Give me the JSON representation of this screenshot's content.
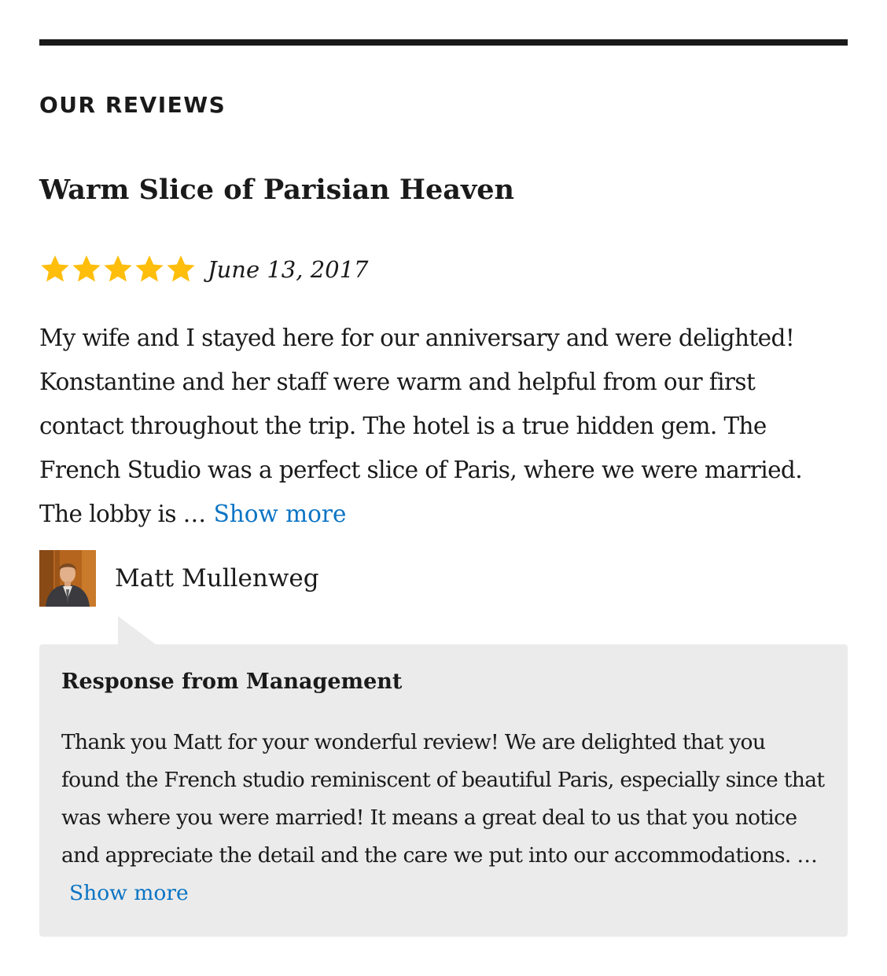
{
  "section": {
    "heading": "OUR REVIEWS"
  },
  "review": {
    "title": "Warm Slice of Parisian Heaven",
    "rating": 5,
    "rating_max": 5,
    "date": "June 13, 2017",
    "body": "My wife and I stayed here for our anniversary and were delighted! Konstantine and her staff were warm and helpful from our first contact throughout the trip. The hotel is a true hidden gem. The French Studio was a perfect slice of Paris, where we were married. The lobby is …",
    "show_more_label": "Show more",
    "author": {
      "name": "Matt Mullenweg",
      "avatar_icon": "author-photo"
    }
  },
  "response": {
    "heading": "Response from Management",
    "body": "Thank you Matt for your wonderful review! We are delighted that you found the French studio reminiscent of beautiful Paris, especially since that was where you were married! It means a great deal to us that you notice and appreciate the detail and the care we put into our accommodations. …",
    "show_more_label": "Show more"
  },
  "colors": {
    "star": "#ffbe0b",
    "link": "#0b74c4",
    "response_background": "#ebebeb",
    "rule": "#1a1a1a"
  }
}
